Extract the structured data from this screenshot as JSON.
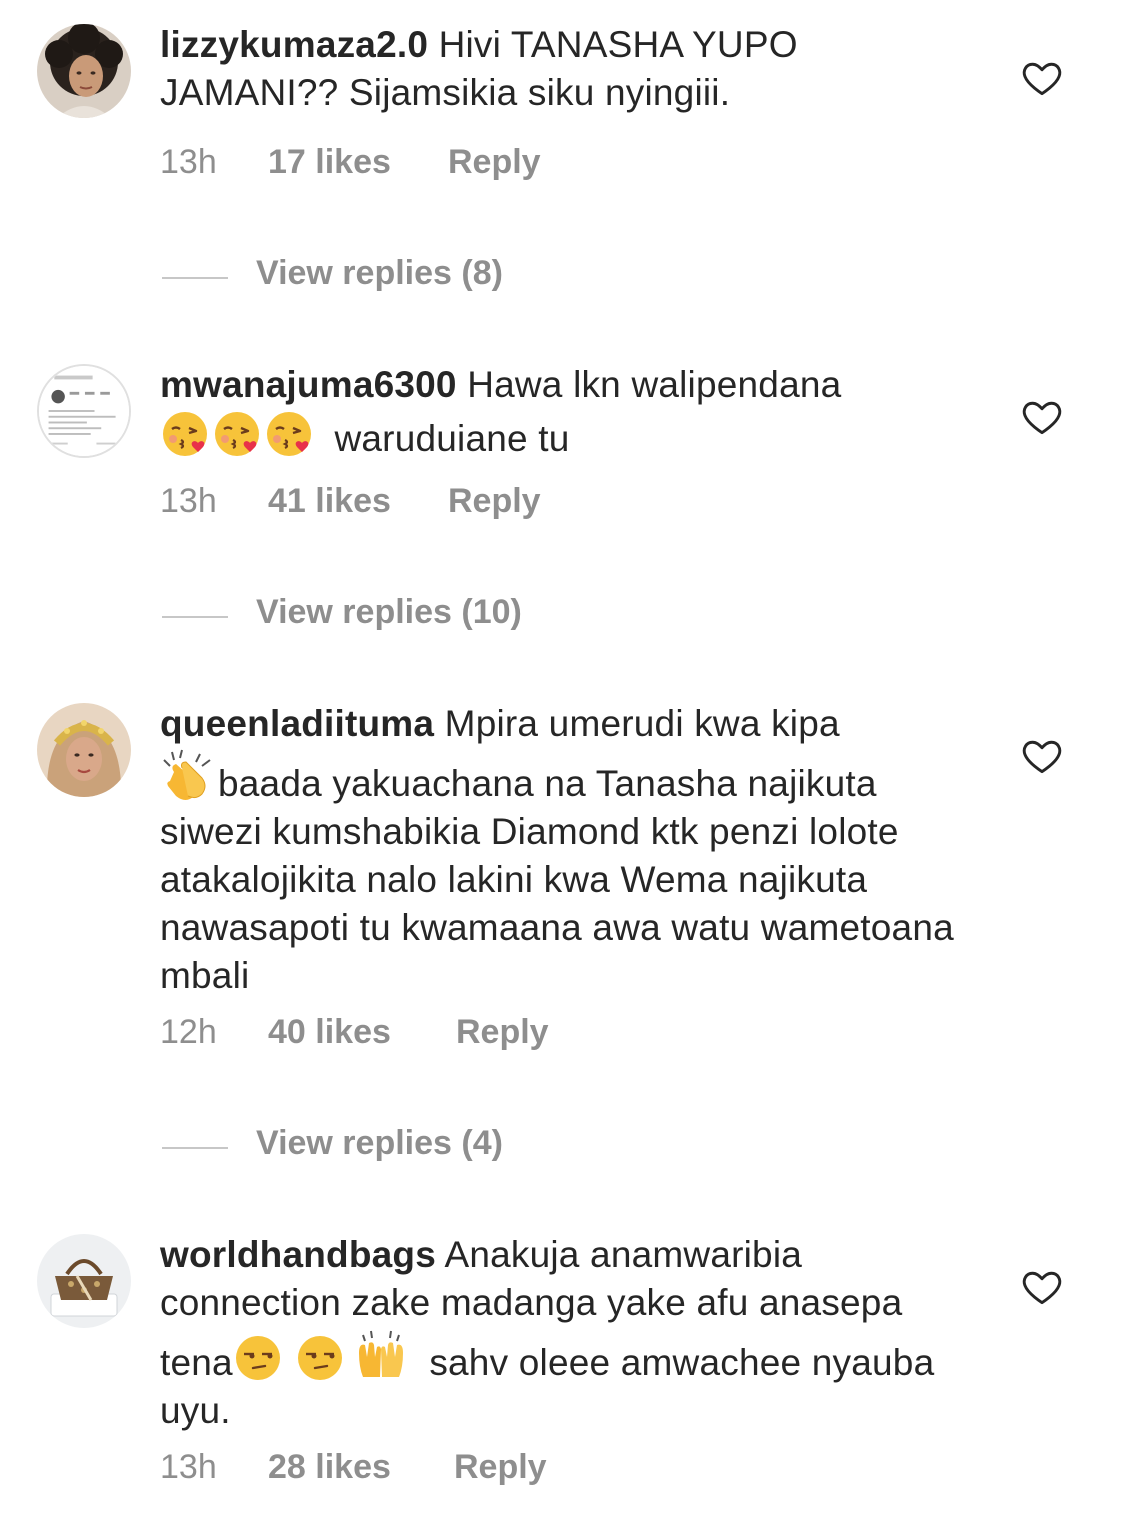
{
  "comments": [
    {
      "username": "lizzykumaza2.0",
      "text_before": "Hivi TANASHA YUPO JAMANI?? Sijamsikia siku nyingiii.",
      "time": "13h",
      "likes": "17 likes",
      "reply": "Reply",
      "view_replies": "View replies (8)",
      "avatar_icon": "profile-photo-woman-curly-hair"
    },
    {
      "username": "mwanajuma6300",
      "text_before": "Hawa lkn walipendana",
      "text_after": "waruduiane tu",
      "emojis": [
        "face-blowing-kiss",
        "face-blowing-kiss",
        "face-blowing-kiss"
      ],
      "time": "13h",
      "likes": "41 likes",
      "reply": "Reply",
      "view_replies": "View replies (10)",
      "avatar_icon": "profile-screenshot-thumbnail"
    },
    {
      "username": "queenladiituma",
      "text_before": "Mpira umerudi kwa kipa",
      "text_after": "baada yakuachana na Tanasha najikuta siwezi kumshabikia Diamond ktk penzi lolote atakalojikita nalo lakini kwa Wema najikuta nawasapoti tu kwamaana awa watu wametoana mbali",
      "emojis": [
        "clapping-hands"
      ],
      "time": "12h",
      "likes": "40 likes",
      "reply": "Reply",
      "view_replies": "View replies (4)",
      "avatar_icon": "profile-photo-woman-headscarf"
    },
    {
      "username": "worldhandbags",
      "text_before": "Anakuja anamwaribia connection zake madanga yake afu anasepa tena",
      "text_after": "sahv oleee amwachee nyauba uyu.",
      "emojis": [
        "unamused-face",
        "unamused-face",
        "raising-hands"
      ],
      "time": "13h",
      "likes": "28 likes",
      "reply": "Reply",
      "avatar_icon": "profile-photo-handbag"
    }
  ],
  "colors": {
    "text": "#262626",
    "secondary": "#8e8e8e",
    "divider": "#c7c7c7",
    "emoji_yellow": "#f7c33a",
    "blush": "#f08a8a",
    "kiss_heart": "#e8314a"
  }
}
